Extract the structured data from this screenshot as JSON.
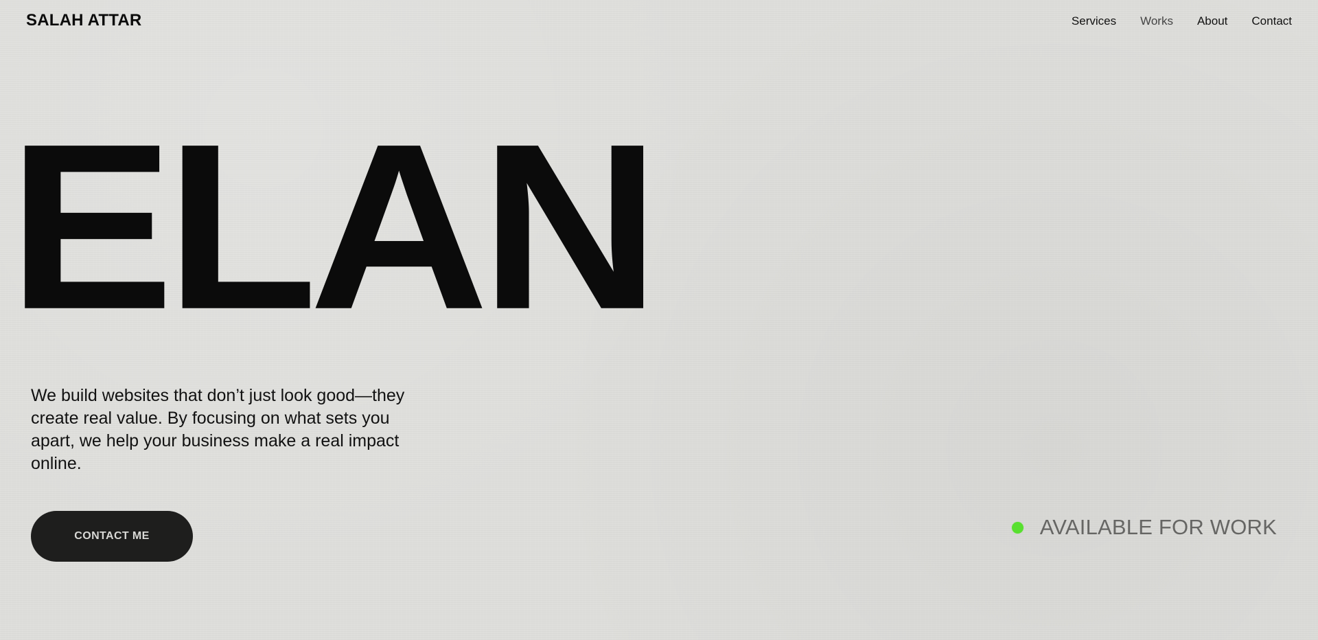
{
  "header": {
    "brand": "SALAH ATTAR",
    "nav": [
      {
        "label": "Services"
      },
      {
        "label": "Works"
      },
      {
        "label": "About"
      },
      {
        "label": "Contact"
      }
    ]
  },
  "hero": {
    "title": "ELAN",
    "description": "We build websites that don’t just look good—they create real value. By focusing on what sets you apart, we help your business make a real impact online.",
    "cta_label": "CONTACT ME"
  },
  "availability": {
    "label": "AVAILABLE FOR WORK",
    "status_color": "#58e02f"
  },
  "colors": {
    "background": "#dededb",
    "text": "#0b0b0b",
    "button": "#1e1e1d",
    "button_text": "#d9d9d6",
    "muted_text": "#666664"
  }
}
